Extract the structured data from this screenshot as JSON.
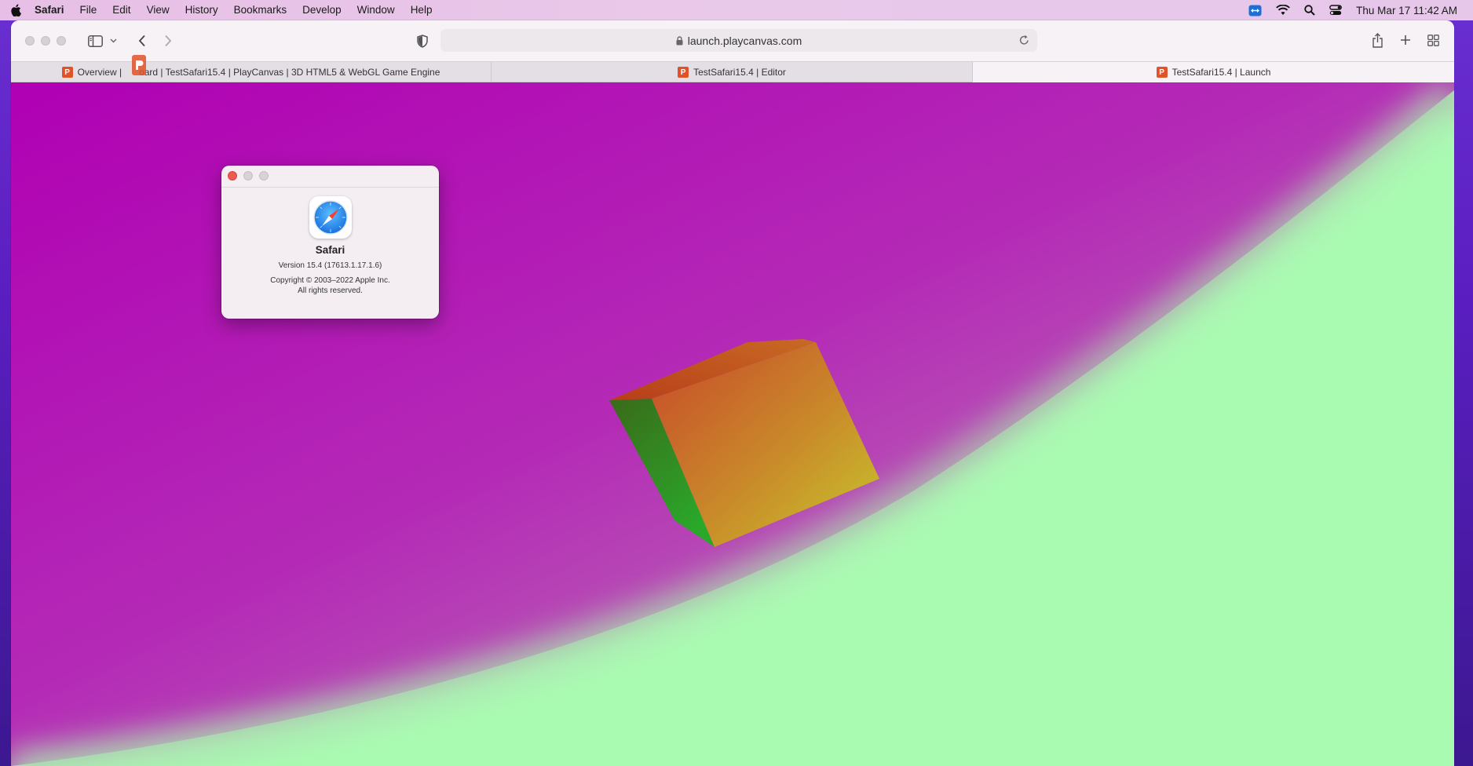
{
  "menubar": {
    "items": [
      "Safari",
      "File",
      "Edit",
      "View",
      "History",
      "Bookmarks",
      "Develop",
      "Window",
      "Help"
    ],
    "status_icons": [
      "teamviewer-icon",
      "wifi-icon",
      "spotlight-search-icon",
      "control-center-icon"
    ],
    "clock": "Thu Mar 17  11:42 AM"
  },
  "toolbar": {
    "url": "launch.playcanvas.com",
    "icons": [
      "sidebar-icon",
      "chevron-down-icon",
      "back-icon",
      "forward-icon",
      "privacy-shield-icon",
      "lock-icon",
      "reload-icon",
      "share-icon",
      "new-tab-icon",
      "tab-overview-icon"
    ]
  },
  "tabs": [
    {
      "label": "Overview | Dashboard | TestSafari15.4 | PlayCanvas | 3D HTML5 & WebGL Game Engine",
      "visible_label_left": "Overview |",
      "visible_label_right": "oard | TestSafari15.4 | PlayCanvas | 3D HTML5 & WebGL Game Engine",
      "active": false
    },
    {
      "label": "TestSafari15.4 | Editor",
      "active": false
    },
    {
      "label": "TestSafari15.4 | Launch",
      "active": true
    }
  ],
  "about_dialog": {
    "app_name": "Safari",
    "version": "Version 15.4 (17613.1.17.1.6)",
    "copyright_line1": "Copyright © 2003–2022 Apple Inc.",
    "copyright_line2": "All rights reserved."
  },
  "colors": {
    "canvas_magenta": "#b000b4",
    "canvas_green": "#aafbb2",
    "accent_playcanvas": "#e0532a",
    "close_red": "#ee5a52"
  }
}
